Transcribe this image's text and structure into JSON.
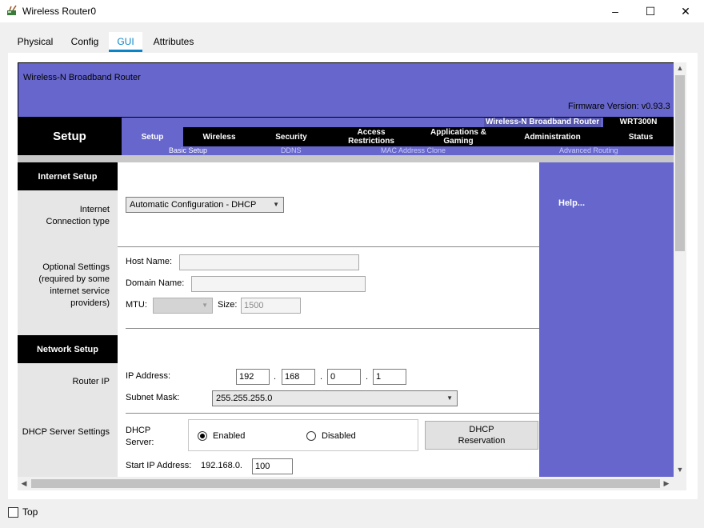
{
  "window": {
    "title": "Wireless Router0",
    "minimize": "–",
    "maximize": "☐",
    "close": "✕"
  },
  "tabs": [
    {
      "label": "Physical",
      "active": false
    },
    {
      "label": "Config",
      "active": false
    },
    {
      "label": "GUI",
      "active": true
    },
    {
      "label": "Attributes",
      "active": false
    }
  ],
  "router": {
    "header_title": "Wireless-N Broadband Router",
    "firmware": "Firmware Version: v0.93.3",
    "product_name": "Wireless-N Broadband Router",
    "model": "WRT300N",
    "section": "Setup",
    "nav": [
      "Setup",
      "Wireless",
      "Security",
      "Access Restrictions",
      "Applications & Gaming",
      "Administration",
      "Status"
    ],
    "subnav": [
      "Basic Setup",
      "DDNS",
      "MAC Address Clone",
      "Advanced Routing"
    ],
    "help": "Help...",
    "internet_setup": {
      "heading": "Internet Setup",
      "conn_type_label": "Internet Connection type",
      "conn_type_value": "Automatic Configuration - DHCP",
      "optional_label": "Optional Settings (required by some internet service providers)",
      "host_name_label": "Host Name:",
      "host_name_value": "",
      "domain_name_label": "Domain Name:",
      "domain_name_value": "",
      "mtu_label": "MTU:",
      "mtu_value": "",
      "size_label": "Size:",
      "size_value": "1500"
    },
    "network_setup": {
      "heading": "Network Setup",
      "router_ip_label": "Router IP",
      "ip_label": "IP Address:",
      "ip": [
        "192",
        "168",
        "0",
        "1"
      ],
      "subnet_label": "Subnet Mask:",
      "subnet_value": "255.255.255.0",
      "dhcp_settings_label": "DHCP Server Settings",
      "dhcp_server_label": "DHCP Server:",
      "enabled_label": "Enabled",
      "disabled_label": "Disabled",
      "dhcp_enabled": true,
      "reservation_label": "DHCP Reservation",
      "start_ip_label": "Start IP Address:",
      "start_ip_prefix": "192.168.0.",
      "start_ip_value": "100"
    }
  },
  "bottom": {
    "top_label": "Top",
    "top_checked": false
  }
}
